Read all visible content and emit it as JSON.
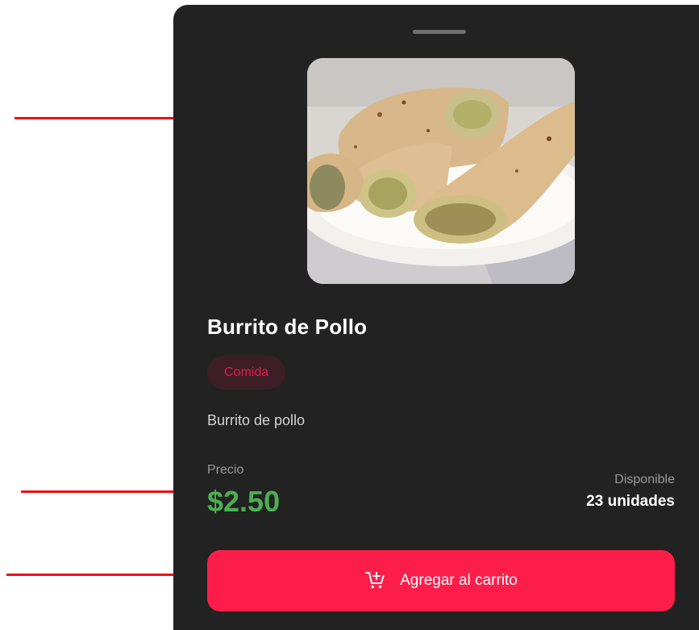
{
  "product": {
    "name": "Burrito de Pollo",
    "category": "Comida",
    "description": "Burrito de pollo",
    "image_alt": "Burritos de pollo en un plato"
  },
  "price": {
    "label": "Precio",
    "value": "$2.50"
  },
  "availability": {
    "label": "Disponible",
    "value": "23 unidades"
  },
  "actions": {
    "add_to_cart_label": "Agregar al carrito",
    "add_to_cart_icon": "add-shopping-cart-icon"
  },
  "colors": {
    "sheet_background": "#222222",
    "price_green": "#4caf50",
    "accent_red": "#fd1d4a",
    "chip_background": "#3d1e26",
    "annotation_arrow": "#ee1010"
  }
}
